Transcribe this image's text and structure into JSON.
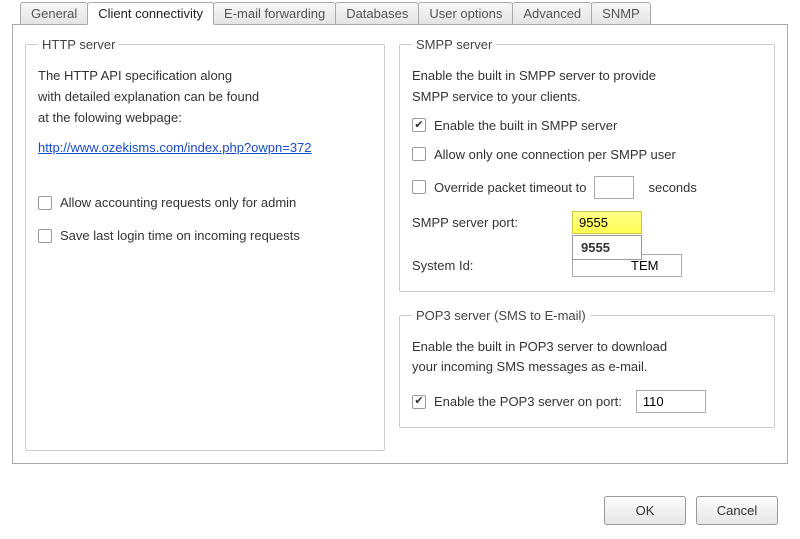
{
  "tabs": {
    "general": "General",
    "client_connectivity": "Client connectivity",
    "email_forwarding": "E-mail forwarding",
    "databases": "Databases",
    "user_options": "User options",
    "advanced": "Advanced",
    "snmp": "SNMP"
  },
  "http": {
    "legend": "HTTP server",
    "explain_l1": "The HTTP API specification along",
    "explain_l2": "with detailed explanation can  be found",
    "explain_l3": "at the folowing webpage:",
    "link": "http://www.ozekisms.com/index.php?owpn=372",
    "allow_admin": "Allow accounting requests only for admin",
    "save_last_login": "Save last login time on incoming requests"
  },
  "smpp": {
    "legend": "SMPP server",
    "explain_l1": "Enable the built in SMPP server to provide",
    "explain_l2": "SMPP service  to your clients.",
    "enable": "Enable the built in SMPP server",
    "one_conn": "Allow only one connection per SMPP user",
    "override": "Override packet timeout to",
    "seconds": "seconds",
    "port_label": "SMPP server port:",
    "port_value": "9555",
    "autocomplete_value": "9555",
    "system_id_label": "System Id:",
    "system_id_value_suffix": "TEM"
  },
  "pop3": {
    "legend": "POP3 server (SMS to E-mail)",
    "explain_l1": "Enable the built in POP3 server to download",
    "explain_l2": "your incoming SMS messages as e-mail.",
    "enable": "Enable the POP3 server on port:",
    "port_value": "110"
  },
  "buttons": {
    "ok": "OK",
    "cancel": "Cancel"
  }
}
